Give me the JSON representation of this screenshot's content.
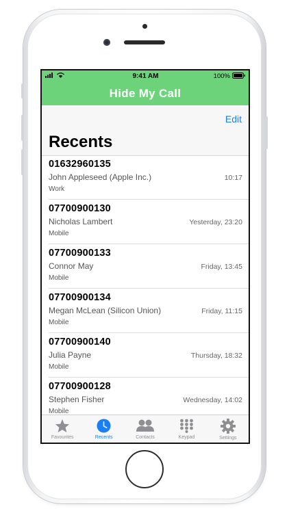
{
  "status_bar": {
    "time": "9:41 AM",
    "battery": "100%"
  },
  "app": {
    "title": "Hide My Call"
  },
  "header": {
    "edit_label": "Edit",
    "title": "Recents"
  },
  "recents": [
    {
      "number": "01632960135",
      "name": "John Appleseed (Apple Inc.)",
      "type": "Work",
      "time": "10:17"
    },
    {
      "number": "07700900130",
      "name": "Nicholas Lambert",
      "type": "Mobile",
      "time": "Yesterday, 23:20"
    },
    {
      "number": "07700900133",
      "name": "Connor May",
      "type": "Mobile",
      "time": "Friday, 13:45"
    },
    {
      "number": "07700900134",
      "name": "Megan McLean (Silicon Union)",
      "type": "Mobile",
      "time": "Friday, 11:15"
    },
    {
      "number": "07700900140",
      "name": "Julia Payne",
      "type": "Mobile",
      "time": "Thursday, 18:32"
    },
    {
      "number": "07700900128",
      "name": "Stephen Fisher",
      "type": "Mobile",
      "time": "Wednesday, 14:02"
    }
  ],
  "tabs": [
    {
      "label": "Favourites",
      "icon": "star-icon"
    },
    {
      "label": "Recents",
      "icon": "clock-icon",
      "active": true
    },
    {
      "label": "Contacts",
      "icon": "contacts-icon"
    },
    {
      "label": "Keypad",
      "icon": "keypad-icon"
    },
    {
      "label": "Settings",
      "icon": "gear-icon"
    }
  ],
  "colors": {
    "navbar": "#6dd37a",
    "accent": "#1a7ef5",
    "inactive_tab": "#8e8e93"
  }
}
